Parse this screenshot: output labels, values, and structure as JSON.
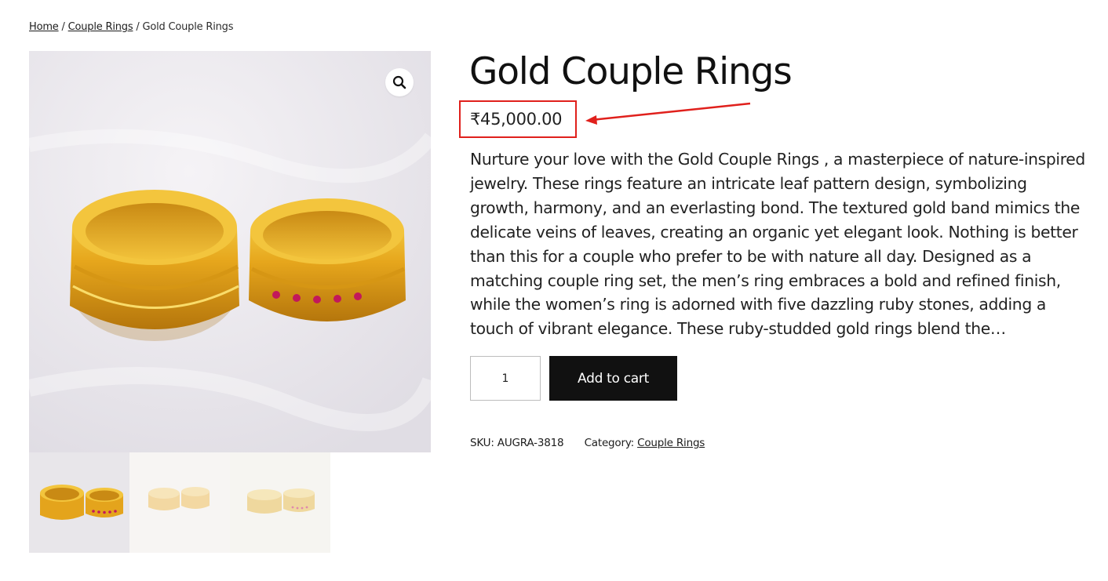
{
  "breadcrumb": {
    "home": "Home",
    "separator": " / ",
    "category": "Couple Rings",
    "current": "Gold Couple Rings"
  },
  "product": {
    "title": "Gold Couple Rings",
    "price": "₹45,000.00",
    "description": "Nurture your love with the Gold Couple Rings , a masterpiece of nature-inspired jewelry. These rings feature an intricate leaf pattern design, symbolizing growth, harmony, and an everlasting bond. The textured gold band mimics the delicate veins of leaves, creating an organic yet elegant look. Nothing is better than this for a couple who prefer to be with nature all day. Designed as a matching couple ring set, the men’s ring embraces a bold and refined finish, while the women’s ring is adorned with five dazzling ruby stones, adding a touch of vibrant elegance. These ruby-studded gold rings blend the…",
    "quantity": "1",
    "add_to_cart_label": "Add to cart",
    "sku_label": "SKU:",
    "sku_value": "AUGRA-3818",
    "category_label": "Category:",
    "category_value": "Couple Rings"
  },
  "gallery": {
    "zoom_icon": "search-icon",
    "thumbnails": [
      "thumbnail-1",
      "thumbnail-2",
      "thumbnail-3"
    ]
  },
  "annotation": {
    "highlight_color": "#e0201c"
  },
  "colors": {
    "button_bg": "#111111",
    "button_text": "#ffffff",
    "gold": "#e0a81f",
    "ruby": "#c2185b"
  }
}
